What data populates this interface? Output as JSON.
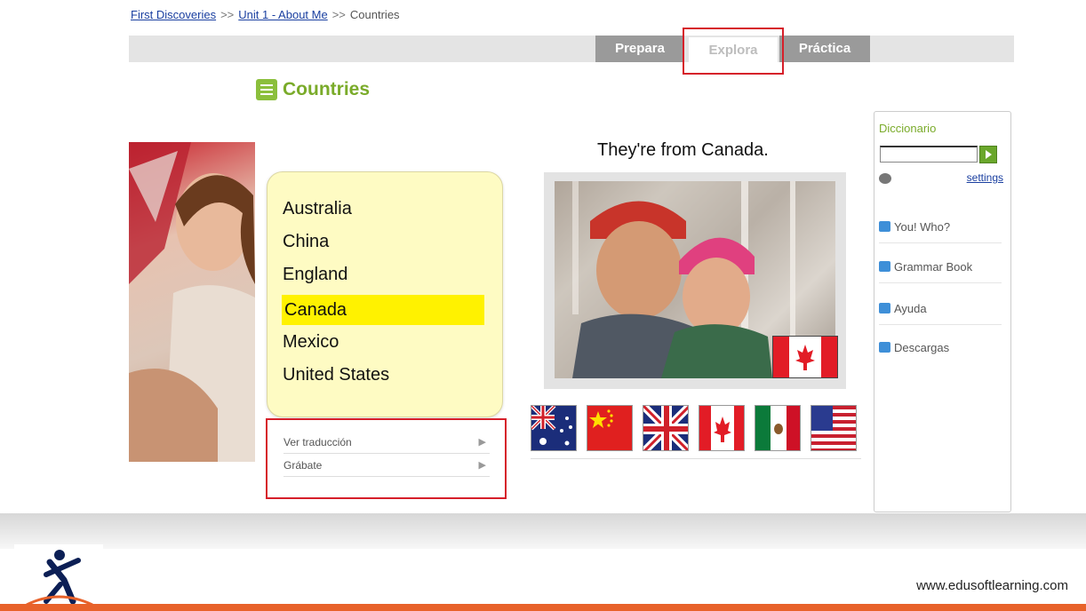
{
  "breadcrumb": {
    "level1": "First Discoveries",
    "sep1": ">>",
    "level2": "Unit 1 - About Me",
    "sep2": ">>",
    "current": "Countries"
  },
  "tabs": {
    "prepara": "Prepara",
    "explora": "Explora",
    "practica": "Práctica",
    "active": "Explora"
  },
  "lesson": {
    "title": "Countries",
    "countries": [
      "Australia",
      "China",
      "England",
      "Canada",
      "Mexico",
      "United States"
    ],
    "selected": "Canada",
    "sentence": "They're from Canada."
  },
  "actions": {
    "translate": "Ver traducción",
    "record": "Grábate"
  },
  "flags": [
    "australia-flag-icon",
    "china-flag-icon",
    "uk-flag-icon",
    "canada-flag-icon",
    "mexico-flag-icon",
    "usa-flag-icon"
  ],
  "dictionary": {
    "title": "Diccionario",
    "input_value": "",
    "settings": "settings",
    "links": [
      "You! Who?",
      "Grammar Book",
      "Ayuda",
      "Descargas"
    ]
  },
  "footer": {
    "url": "www.edusoftlearning.com"
  },
  "colors": {
    "accent_green": "#7aab2a",
    "highlight_yellow": "#fff200",
    "annotation_red": "#d61f2a",
    "footer_orange": "#e8622a"
  }
}
